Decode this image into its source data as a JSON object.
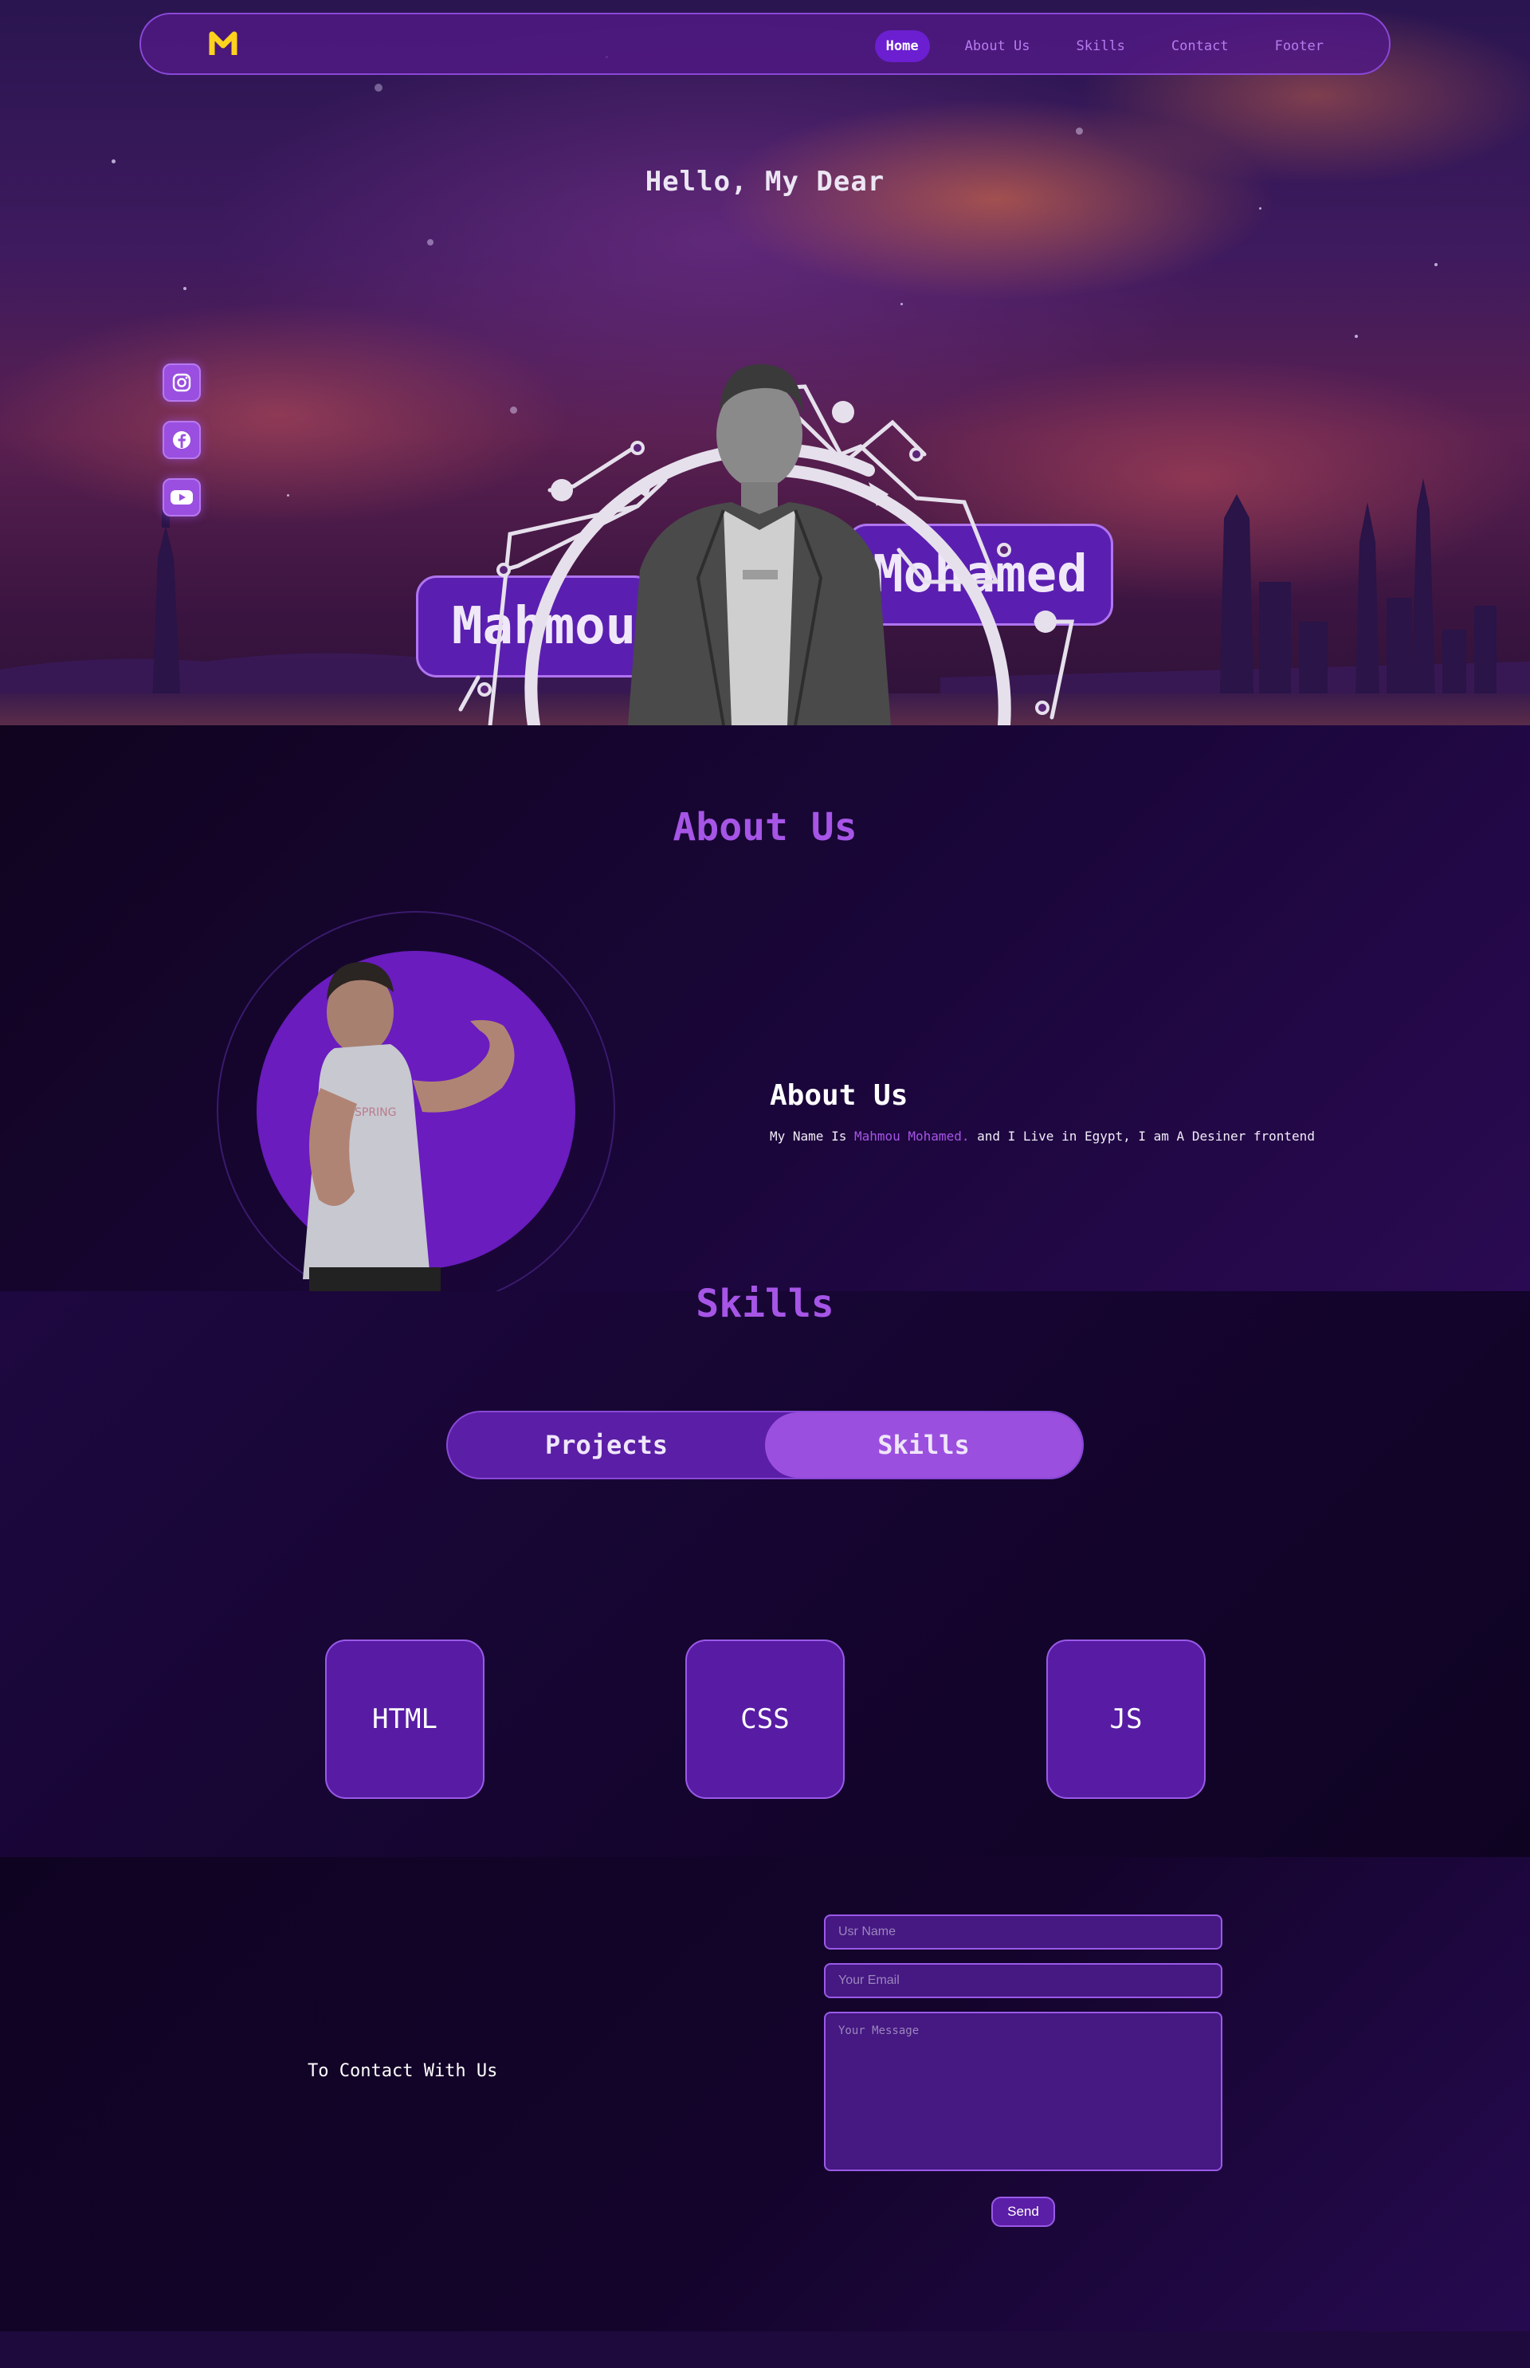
{
  "navbar": {
    "logo": "M",
    "links": [
      "Home",
      "About Us",
      "Skills",
      "Contact",
      "Footer"
    ]
  },
  "hero": {
    "greeting": "Hello, My Dear",
    "name_left": "Mahmou",
    "name_right": "Mohamed",
    "social_icons": [
      "instagram-icon",
      "facebook-icon",
      "youtube-icon"
    ]
  },
  "about": {
    "section_title": "About Us",
    "heading": "About Us",
    "text_before": "My Name Is ",
    "text_highlight": "Mahmou Mohamed.",
    "text_after": " and I Live in Egypt, I am A Desiner frontend"
  },
  "skills": {
    "section_title": "Skills",
    "toggle": [
      "Projects",
      "Skills"
    ],
    "items": [
      "HTML",
      "CSS",
      "JS"
    ]
  },
  "contact": {
    "label": "To Contact With Us",
    "name_placeholder": "Usr Name",
    "email_placeholder": "Your Email",
    "message_placeholder": "Your Message",
    "send_label": "Send"
  },
  "colors": {
    "accent": "#a655e6",
    "logo": "#ffd21e",
    "nav_active": "#6b1fd0"
  }
}
